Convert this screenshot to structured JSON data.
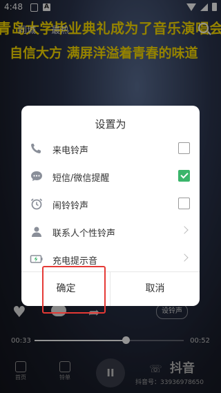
{
  "status": {
    "time": "4:48"
  },
  "background": {
    "caption1": "青岛大学毕业典礼成为了音乐演唱会",
    "caption2": "自信大方 满屏洋溢着青春的味道",
    "tab1": "同城",
    "tab2": "最热"
  },
  "underlay": {
    "ringtone_pill": "设铃声",
    "time_elapsed": "00:33",
    "time_total": "00:52",
    "progress_fraction": 0.61,
    "nav_home": "首页",
    "nav_ringtone": "铃单",
    "play_symbol": "II",
    "douyin_brand": "抖音",
    "douyin_id": "抖音号：33936978650"
  },
  "dialog": {
    "title": "设置为",
    "options": [
      {
        "label": "来电铃声",
        "icon": "phone-icon",
        "checked": false
      },
      {
        "label": "短信/微信提醒",
        "icon": "message-icon",
        "checked": true
      },
      {
        "label": "闹铃铃声",
        "icon": "alarm-clock-icon",
        "checked": false
      },
      {
        "label": "联系人个性铃声",
        "icon": "contact-icon",
        "arrow": true
      },
      {
        "label": "充电提示音",
        "icon": "battery-charging-icon",
        "arrow": true
      }
    ],
    "confirm": "确定",
    "cancel": "取消"
  },
  "colors": {
    "accent_green": "#3bb56b",
    "annotation_red": "#e53935",
    "caption_yellow": "#ffe100"
  }
}
